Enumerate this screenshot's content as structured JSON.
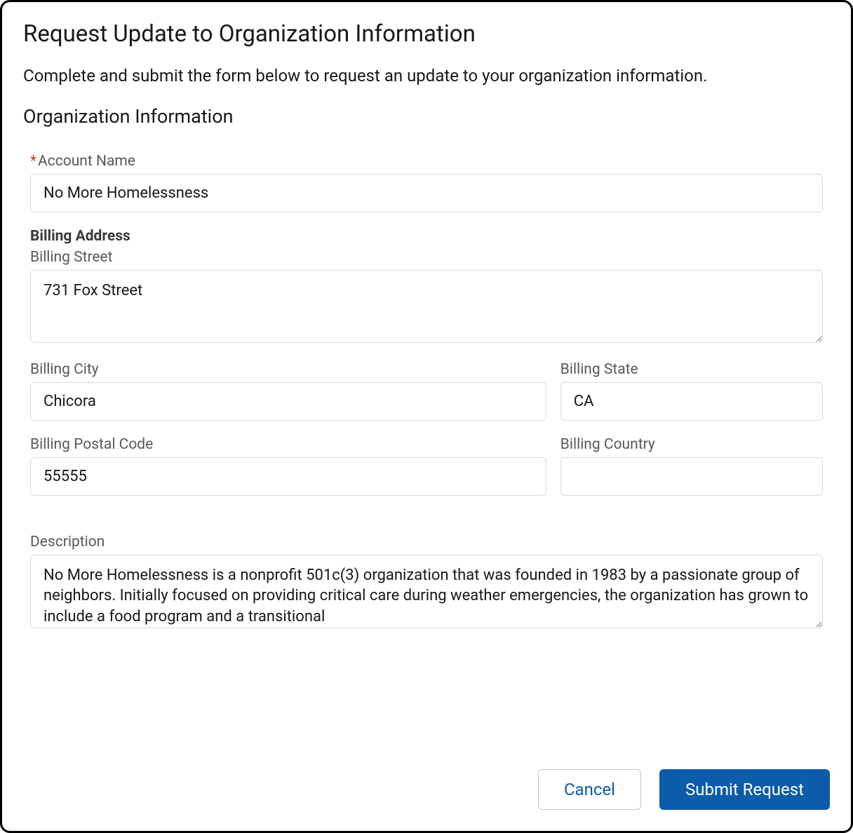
{
  "header": {
    "title": "Request Update to Organization Information",
    "subtitle": "Complete and submit the form below to request an update to your organization information."
  },
  "section": {
    "heading": "Organization Information"
  },
  "fields": {
    "account_name": {
      "label": "Account Name",
      "value": "No More Homelessness",
      "required": true
    },
    "billing_address_heading": "Billing Address",
    "billing_street": {
      "label": "Billing Street",
      "value": "731 Fox Street"
    },
    "billing_city": {
      "label": "Billing City",
      "value": "Chicora"
    },
    "billing_state": {
      "label": "Billing State",
      "value": "CA"
    },
    "billing_postal": {
      "label": "Billing Postal Code",
      "value": "55555"
    },
    "billing_country": {
      "label": "Billing Country",
      "value": ""
    },
    "description": {
      "label": "Description",
      "value": "No More Homelessness is a nonprofit 501c(3) organization that was founded in 1983 by a passionate group of neighbors. Initially focused on providing critical care during weather emergencies, the organization has grown to include a food program and a transitional"
    }
  },
  "buttons": {
    "cancel": "Cancel",
    "submit": "Submit Request"
  }
}
